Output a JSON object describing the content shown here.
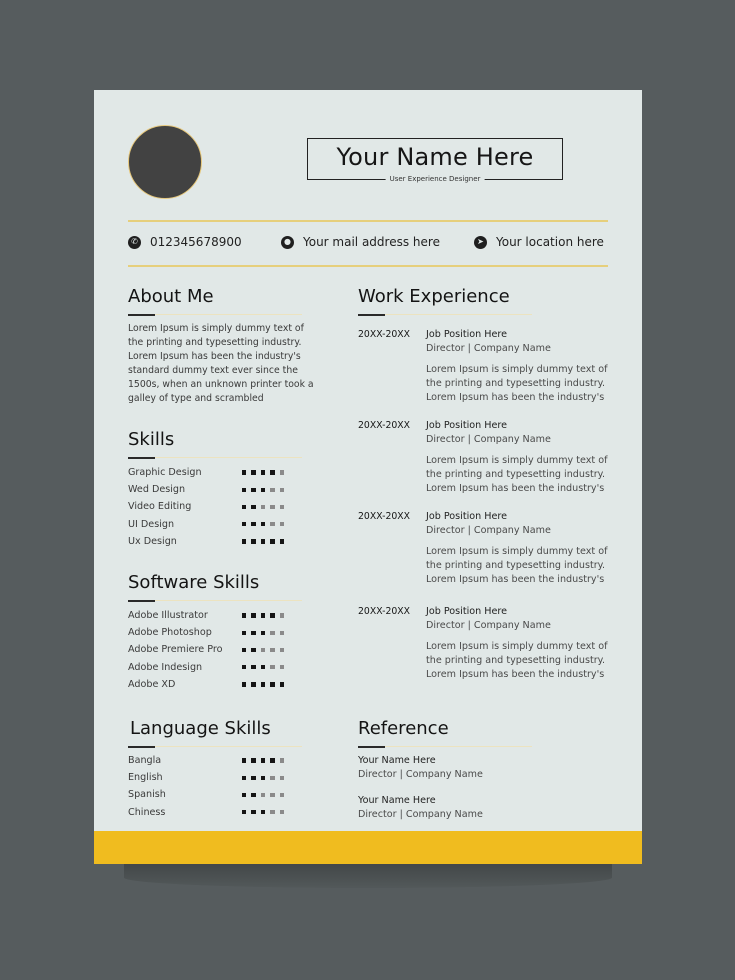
{
  "header": {
    "name": "Your Name Here",
    "role": "User Experience Designer"
  },
  "contact": {
    "phone": {
      "icon": "phone-icon",
      "text": "012345678900"
    },
    "email": {
      "icon": "globe-icon",
      "text": "Your mail address here"
    },
    "location": {
      "icon": "location-arrow-icon",
      "text": "Your location here"
    }
  },
  "about": {
    "title": "About Me",
    "text": "Lorem Ipsum is simply dummy text of the printing and typesetting industry. Lorem Ipsum has been the industry's standard dummy text ever since the 1500s, when an unknown printer took a galley of type and scrambled"
  },
  "skills": {
    "title": "Skills",
    "max": 5,
    "items": [
      {
        "label": "Graphic Design",
        "level": 4
      },
      {
        "label": "Wed Design",
        "level": 3
      },
      {
        "label": "Video Editing",
        "level": 2
      },
      {
        "label": "UI Design",
        "level": 3
      },
      {
        "label": "Ux Design",
        "level": 5
      }
    ]
  },
  "software": {
    "title": "Software Skills",
    "max": 5,
    "items": [
      {
        "label": "Adobe Illustrator",
        "level": 4
      },
      {
        "label": "Adobe Photoshop",
        "level": 3
      },
      {
        "label": "Adobe Premiere Pro",
        "level": 2
      },
      {
        "label": "Adobe Indesign",
        "level": 3
      },
      {
        "label": "Adobe XD",
        "level": 5
      }
    ]
  },
  "languages": {
    "title": "Language Skills",
    "max": 5,
    "items": [
      {
        "label": "Bangla",
        "level": 4
      },
      {
        "label": "English",
        "level": 3
      },
      {
        "label": "Spanish",
        "level": 2
      },
      {
        "label": "Chiness",
        "level": 3
      }
    ]
  },
  "work": {
    "title": "Work Experience",
    "jobs": [
      {
        "period": "20XX-20XX",
        "position": "Job Position Here",
        "company": "Director |  Company Name",
        "desc": "Lorem Ipsum is simply dummy text of the printing and typesetting industry. Lorem Ipsum has been the industry's"
      },
      {
        "period": "20XX-20XX",
        "position": "Job Position Here",
        "company": "Director |  Company Name",
        "desc": "Lorem Ipsum is simply dummy text of the printing and typesetting industry. Lorem Ipsum has been the industry's"
      },
      {
        "period": "20XX-20XX",
        "position": "Job Position Here",
        "company": "Director |  Company Name",
        "desc": "Lorem Ipsum is simply dummy text of the printing and typesetting industry. Lorem Ipsum has been the industry's"
      },
      {
        "period": "20XX-20XX",
        "position": "Job Position Here",
        "company": "Director |  Company Name",
        "desc": "Lorem Ipsum is simply dummy text of the printing and typesetting industry. Lorem Ipsum has been the industry's"
      }
    ]
  },
  "reference": {
    "title": "Reference",
    "items": [
      {
        "name": "Your Name Here",
        "company": "Director |  Company Name"
      },
      {
        "name": "Your Name Here",
        "company": "Director |  Company Name"
      }
    ]
  },
  "colors": {
    "accent": "#f0bc1f",
    "page": "#e1e8e7",
    "background": "#565c5e",
    "text": "#1d1d1d"
  }
}
